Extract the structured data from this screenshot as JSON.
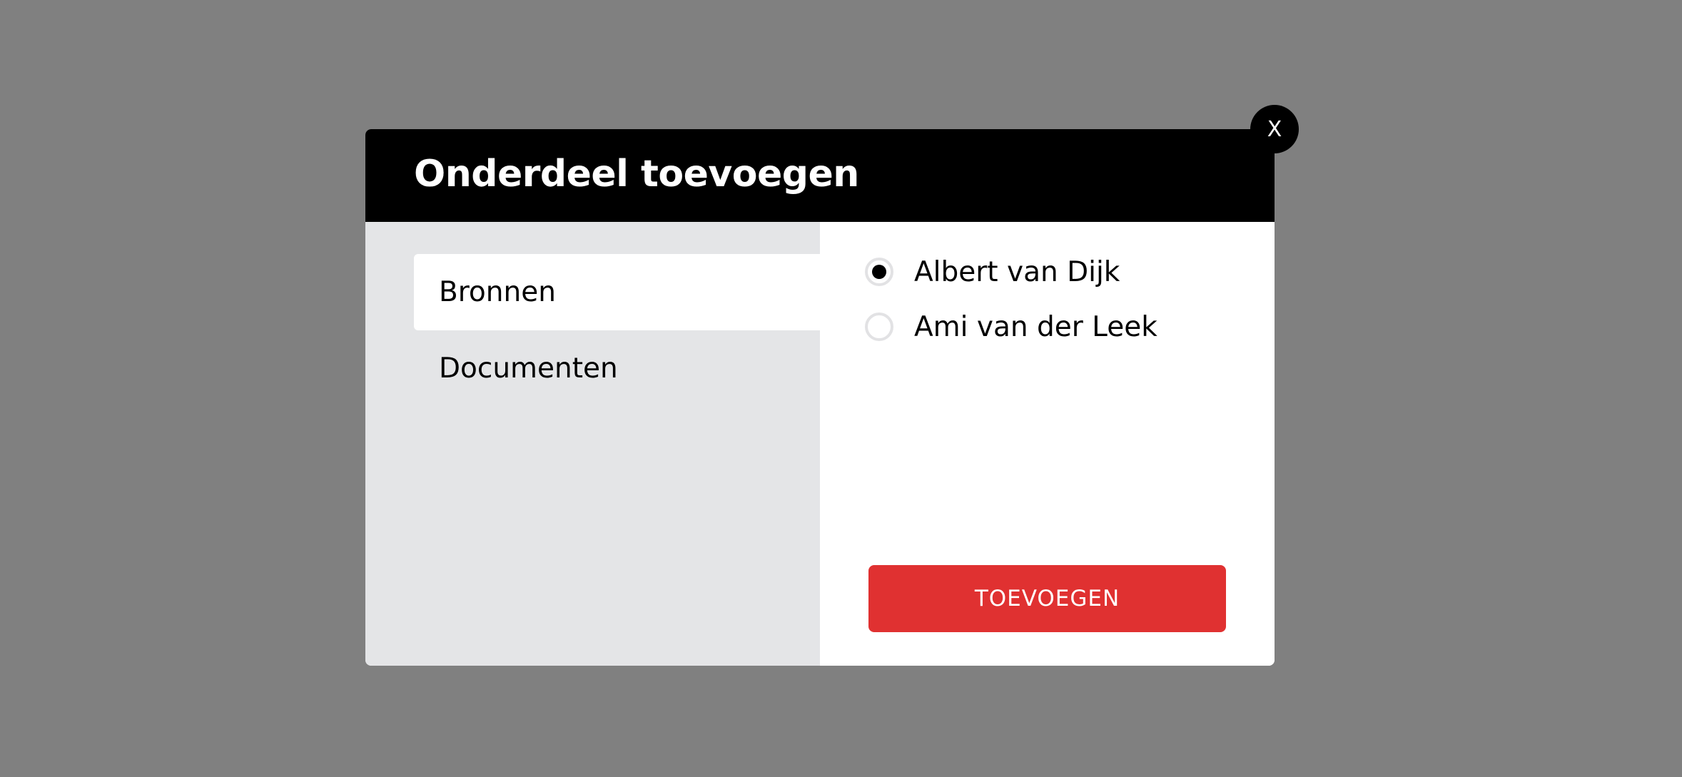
{
  "modal": {
    "title": "Onderdeel toevoegen",
    "close_label": "X"
  },
  "categories": [
    {
      "label": "Bronnen",
      "active": true
    },
    {
      "label": "Documenten",
      "active": false
    }
  ],
  "options": [
    {
      "label": "Albert van Dijk",
      "checked": true
    },
    {
      "label": "Ami van der Leek",
      "checked": false
    }
  ],
  "actions": {
    "add_label": "TOEVOEGEN",
    "add_color": "#e03131"
  },
  "colors": {
    "backdrop": "#808080",
    "header": "#000000",
    "left_panel": "#e4e5e7",
    "right_panel": "#ffffff"
  },
  "icons": {
    "close": "close-icon"
  }
}
